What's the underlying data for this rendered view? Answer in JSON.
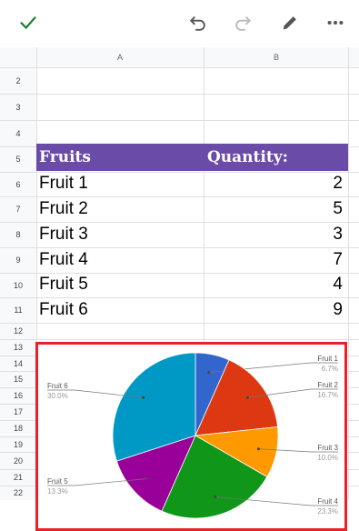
{
  "toolbar": {
    "confirm_icon": "checkmark-icon",
    "undo_icon": "undo-icon",
    "redo_icon": "redo-icon",
    "edit_icon": "pencil-icon",
    "more_icon": "more-horizontal-icon",
    "accent_color": "#188038"
  },
  "columns": [
    "A",
    "B"
  ],
  "rows": [
    "2",
    "3",
    "4",
    "5",
    "6",
    "7",
    "8",
    "9",
    "10",
    "11",
    "12",
    "13",
    "14",
    "15",
    "16",
    "17",
    "18",
    "19",
    "20",
    "21",
    "22"
  ],
  "table": {
    "header": {
      "fruits": "Fruits",
      "quantity": "Quantity:",
      "color": "#6b4ba8"
    },
    "rows": [
      {
        "fruit": "Fruit 1",
        "qty": "2"
      },
      {
        "fruit": "Fruit 2",
        "qty": "5"
      },
      {
        "fruit": "Fruit 3",
        "qty": "3"
      },
      {
        "fruit": "Fruit 4",
        "qty": "7"
      },
      {
        "fruit": "Fruit 5",
        "qty": "4"
      },
      {
        "fruit": "Fruit 6",
        "qty": "9"
      }
    ]
  },
  "chart_data": {
    "type": "pie",
    "title": "",
    "border_color": "#e8222b",
    "slices": [
      {
        "label": "Fruit 1",
        "value": 2,
        "percent": "6.7%",
        "color": "#3366cc"
      },
      {
        "label": "Fruit 2",
        "value": 5,
        "percent": "16.7%",
        "color": "#dc3912"
      },
      {
        "label": "Fruit 3",
        "value": 3,
        "percent": "10.0%",
        "color": "#ff9900"
      },
      {
        "label": "Fruit 4",
        "value": 7,
        "percent": "23.3%",
        "color": "#109618"
      },
      {
        "label": "Fruit 5",
        "value": 4,
        "percent": "13.3%",
        "color": "#990099"
      },
      {
        "label": "Fruit 6",
        "value": 9,
        "percent": "30.0%",
        "color": "#0099c6"
      }
    ]
  }
}
